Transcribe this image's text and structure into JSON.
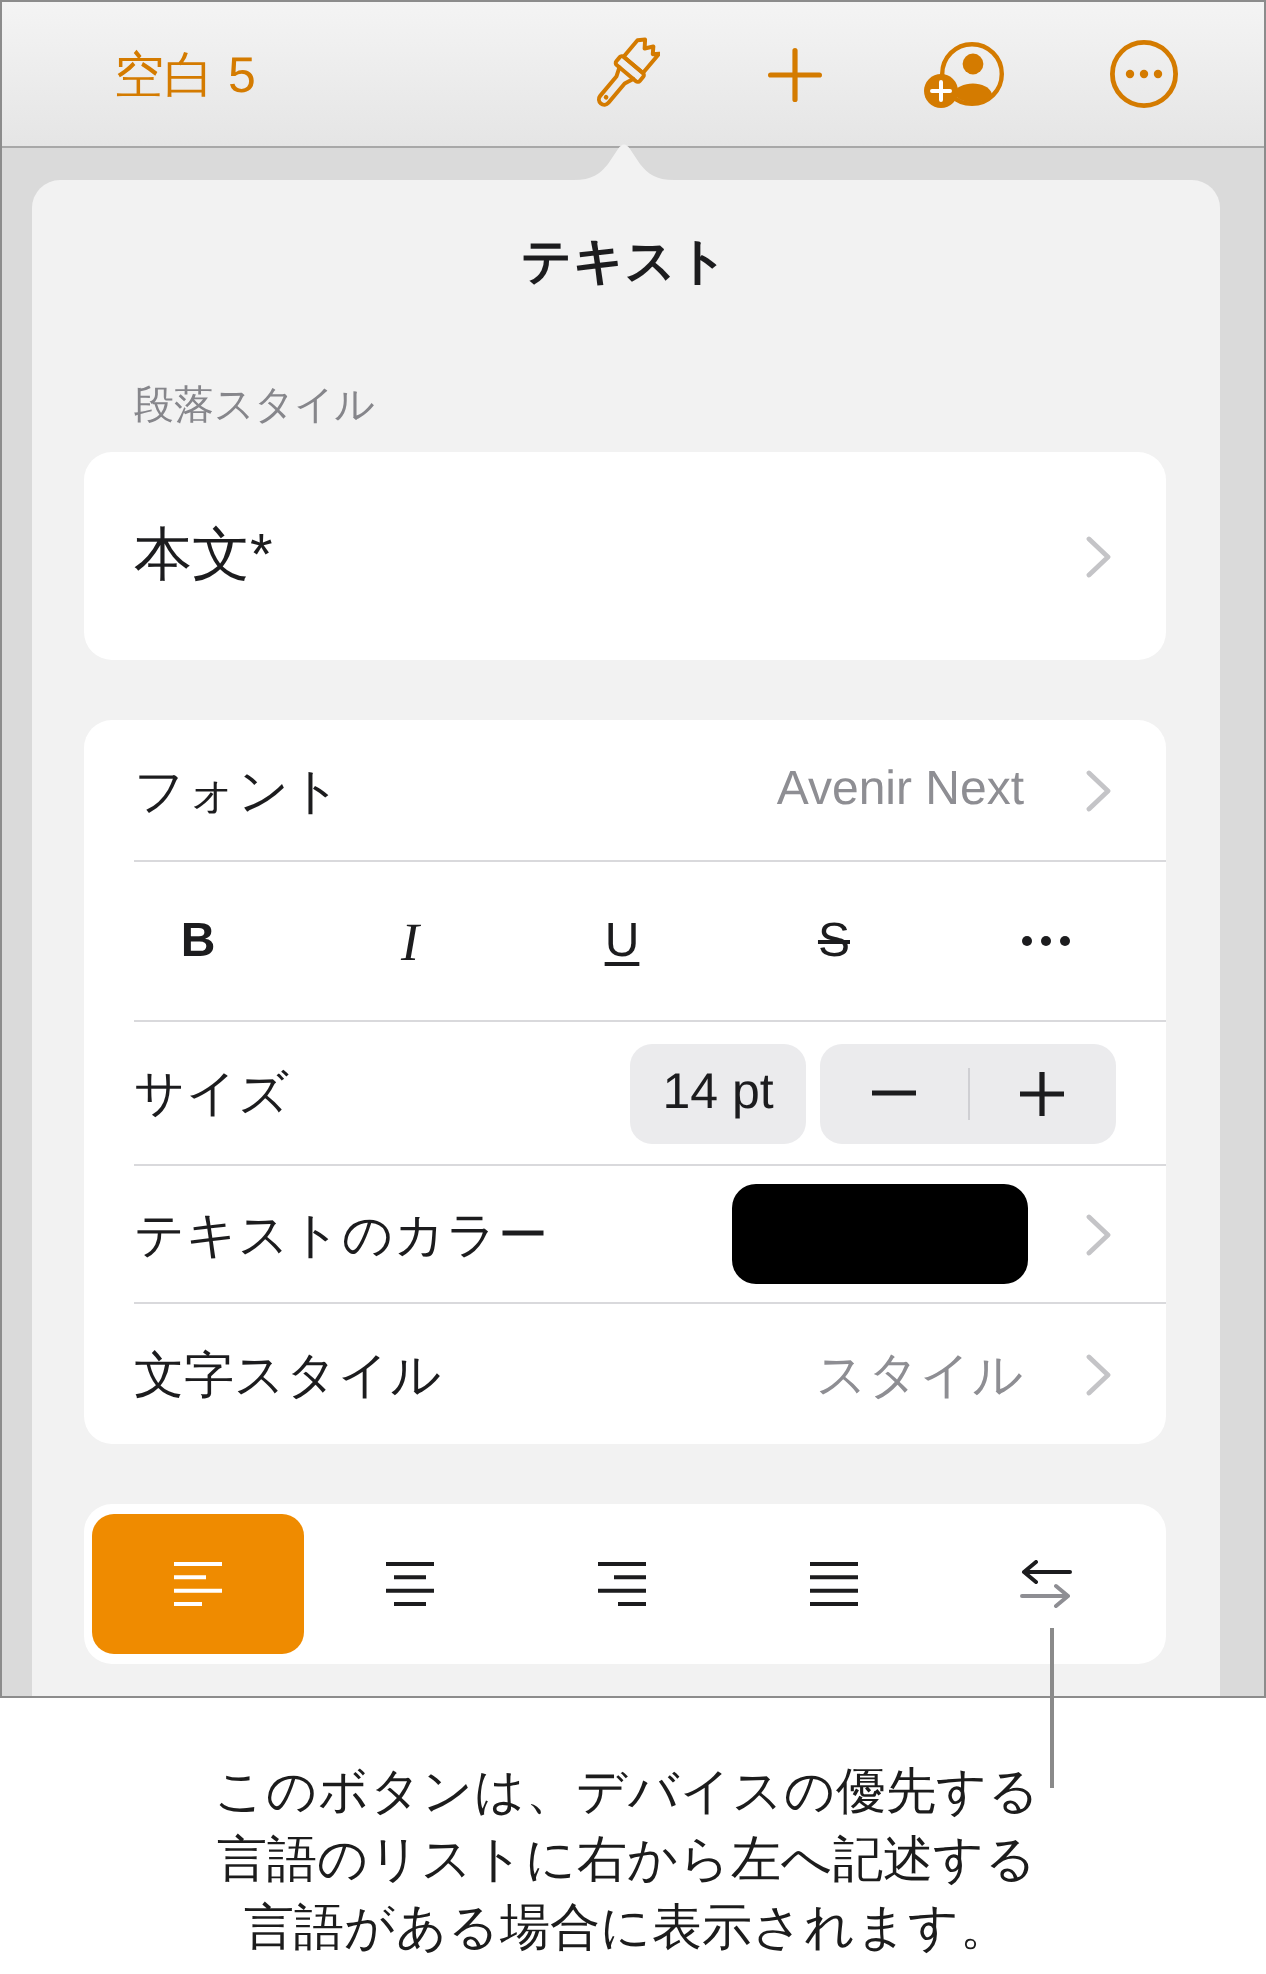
{
  "toolbar": {
    "document_title": "空白 5"
  },
  "popover": {
    "title": "テキスト",
    "paragraph_style": {
      "header": "段落スタイル",
      "value": "本文*"
    },
    "rows": [
      {
        "kind": "link",
        "label": "フォント",
        "value": "Avenir Next"
      },
      {
        "kind": "styles",
        "buttons": [
          {
            "kind": "bold",
            "label": "B"
          },
          {
            "kind": "italic",
            "label": "I"
          },
          {
            "kind": "underline",
            "label": "U"
          },
          {
            "kind": "strikethrough",
            "label": "S"
          },
          {
            "kind": "more"
          }
        ]
      },
      {
        "kind": "stepper",
        "label": "サイズ",
        "value": "14 pt"
      },
      {
        "kind": "color",
        "label": "テキストのカラー",
        "color": "#000000"
      },
      {
        "kind": "link",
        "label": "文字スタイル",
        "value": "スタイル"
      }
    ],
    "alignment": [
      {
        "kind": "left",
        "selected": true
      },
      {
        "kind": "center",
        "selected": false
      },
      {
        "kind": "right",
        "selected": false
      },
      {
        "kind": "justify",
        "selected": false
      },
      {
        "kind": "rtl",
        "selected": false
      }
    ]
  },
  "callout": {
    "text": "このボタンは、デバイスの優先する言語のリストに右から左へ記述する言語がある場合に表示されます。"
  }
}
